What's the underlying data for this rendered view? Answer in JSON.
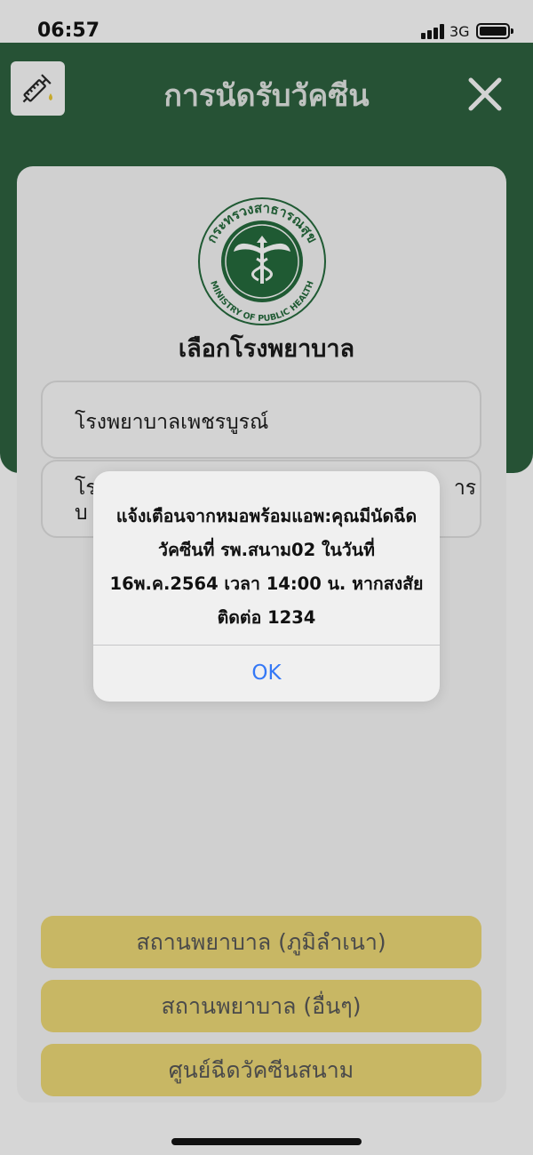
{
  "status_bar": {
    "time": "06:57",
    "network": "3G"
  },
  "header": {
    "title": "การนัดรับวัคซีน"
  },
  "logo": {
    "text_top": "กระทรวงสาธารณสุข",
    "text_bottom": "MINISTRY OF PUBLIC HEALTH"
  },
  "card": {
    "title": "เลือกโรงพยาบาล"
  },
  "hospital_list": [
    {
      "label": "โรงพยาบาลเพชรบูรณ์"
    },
    {
      "label": "โร                                                       าร\nบ"
    }
  ],
  "buttons": {
    "hometown": "สถานพยาบาล (ภูมิลำเนา)",
    "other": "สถานพยาบาล (อื่นๆ)",
    "field_center": "ศูนย์ฉีดวัคซีนสนาม"
  },
  "alert": {
    "message": "แจ้งเตือนจากหมอพร้อมแอพ:คุณมีนัดฉีดวัคซีนที่ รพ.สนาม02 ในวันที่ 16พ.ค.2564 เวลา 14:00 น. หากสงสัยติดต่อ 1234",
    "ok_label": "OK"
  },
  "colors": {
    "header_green": "#265235",
    "button_yellow": "#c8b764",
    "alert_blue": "#3478f6"
  },
  "icons": {
    "app": "syringe-icon",
    "close": "close-icon",
    "logo": "ministry-logo"
  }
}
